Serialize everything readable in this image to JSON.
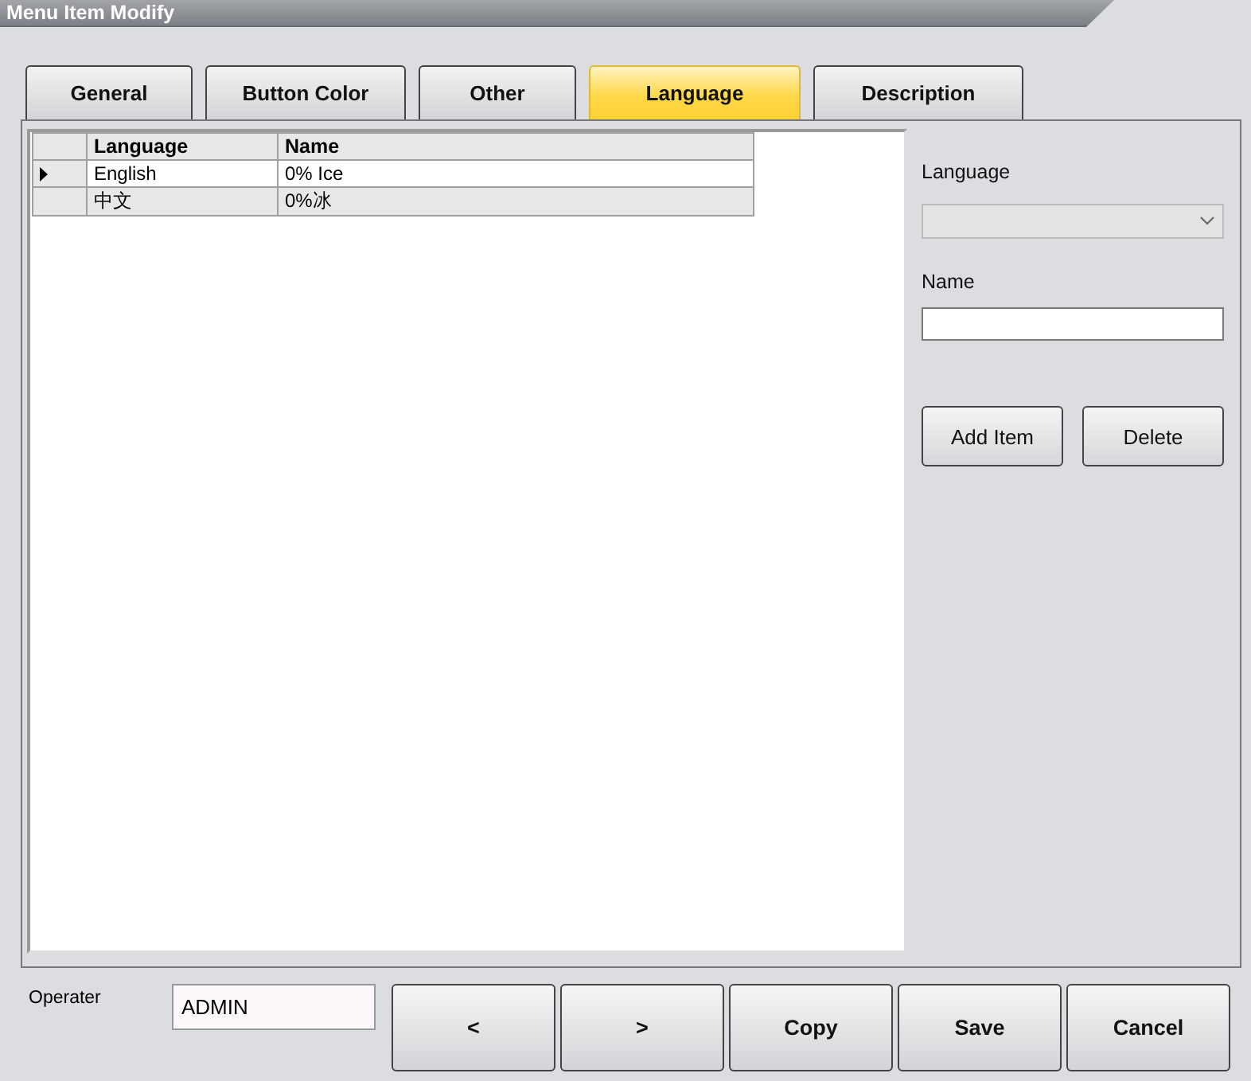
{
  "window": {
    "title": "Menu Item Modify"
  },
  "tabs": [
    {
      "label": "General",
      "selected": false
    },
    {
      "label": "Button Color",
      "selected": false
    },
    {
      "label": "Other",
      "selected": false
    },
    {
      "label": "Language",
      "selected": true
    },
    {
      "label": "Description",
      "selected": false
    }
  ],
  "table": {
    "columns": [
      "Language",
      "Name"
    ],
    "rows": [
      {
        "cells": [
          "English",
          "0% Ice"
        ],
        "selected": true
      },
      {
        "cells": [
          "中文",
          "0%冰"
        ],
        "selected": false
      }
    ]
  },
  "side_panel": {
    "language_label": "Language",
    "language_combo": {
      "disabled": true
    },
    "name_label": "Name",
    "buttons": [
      "Add Item",
      "Delete"
    ]
  },
  "footer": {
    "operator_label": "Operater",
    "operator_value": "ADMIN",
    "buttons": [
      "<",
      ">",
      "Copy",
      "Save",
      "Cancel"
    ]
  }
}
